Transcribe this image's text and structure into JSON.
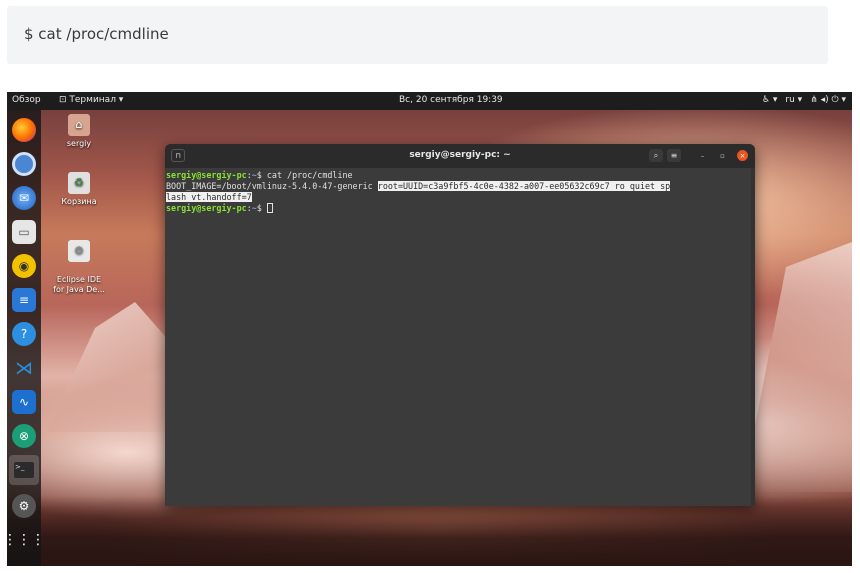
{
  "code_block": {
    "command": "$ cat /proc/cmdline"
  },
  "top_panel": {
    "activities": "Обзор",
    "app_menu": "⊡ Терминал ▾",
    "clock": "Вс, 20 сентября  19:39",
    "tray": {
      "accessibility": "♿︎ ▾",
      "language": "ru ▾",
      "system": "⋔ ◂) ⏻ ▾"
    }
  },
  "dock": {
    "items": [
      "firefox-icon",
      "chromium-icon",
      "thunderbird-icon",
      "files-icon",
      "rhythmbox-icon",
      "writer-icon",
      "help-icon",
      "vscode-icon",
      "system-monitor-icon",
      "app-icon",
      "terminal-icon",
      "settings-icon",
      "show-apps-icon"
    ]
  },
  "desktop_icons": [
    {
      "label": "sergiy"
    },
    {
      "label": "Корзина"
    },
    {
      "label": "Eclipse IDE\nfor Java De..."
    }
  ],
  "terminal": {
    "title": "sergiy@sergiy-pc: ~",
    "lines": {
      "l1_user": "sergiy@sergiy-pc",
      "l1_colon": ":",
      "l1_path": "~",
      "l1_cmd": "$ cat /proc/cmdline",
      "l2_a": "BOOT_IMAGE=/boot/vmlinuz-5.4.0-47-generic ",
      "l2_b": "root=UUID=c3a9fbf5-4c0e-4382-a007-ee05632c69c7 ro quiet sp",
      "l3": "lash vt.handoff=7",
      "l4_user": "sergiy@sergiy-pc",
      "l4_colon": ":",
      "l4_path": "~",
      "l4_cmd": "$ "
    }
  },
  "colors": {
    "terminal_bg": "#3b3b3b",
    "prompt_user": "#8ae234",
    "prompt_path": "#729fcf",
    "panel_bg": "#1d1d1d"
  }
}
